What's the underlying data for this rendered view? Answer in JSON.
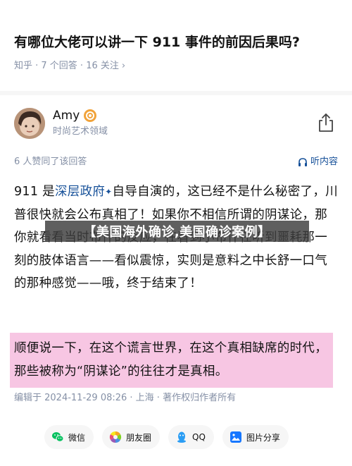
{
  "question": {
    "title": "有哪位大佬可以讲一下 911 事件的前因后果吗?",
    "meta": "知乎 · 7 个回答 · 16 关注",
    "chevron": "›"
  },
  "author": {
    "name": "Amy",
    "bio": "时尚艺术领域"
  },
  "answer": {
    "vote_line": "6 人赞同了该回答",
    "listen_label": "听内容",
    "p1_a": "911 是",
    "p1_link": "深层政府",
    "p1_sup": "✦",
    "p1_b": "自导自演的，这已经不是什么秘密了，川普很快就会公布真相了！如果你不相信所谓的阴谋论，那你就看看当时布什的反应，在看到小布什在听到噩耗那一刻的肢体语言——看似震惊，实则是意料之中长舒一口气的那种感觉——哦，终于结束了！",
    "highlight": "顺便说一下，在这个谎言世界，在这个真相缺席的时代，那些被称为“阴谋论”的往往才是真相。",
    "edit_info": "编辑于 2024-11-29 08:26 · 上海 · 著作权归作者所有"
  },
  "overlay": {
    "text": "【美国海外确诊,美国确诊案例】"
  },
  "share": {
    "wechat": "微信",
    "moments": "朋友圈",
    "qq": "QQ",
    "image_share": "图片分享"
  },
  "colors": {
    "link": "#175199",
    "meta": "#8590a6",
    "highlight_bg": "#f7c6e3",
    "wechat_green": "#07c160",
    "qq_blue": "#2a9df4",
    "image_share_blue": "#1677ff"
  }
}
